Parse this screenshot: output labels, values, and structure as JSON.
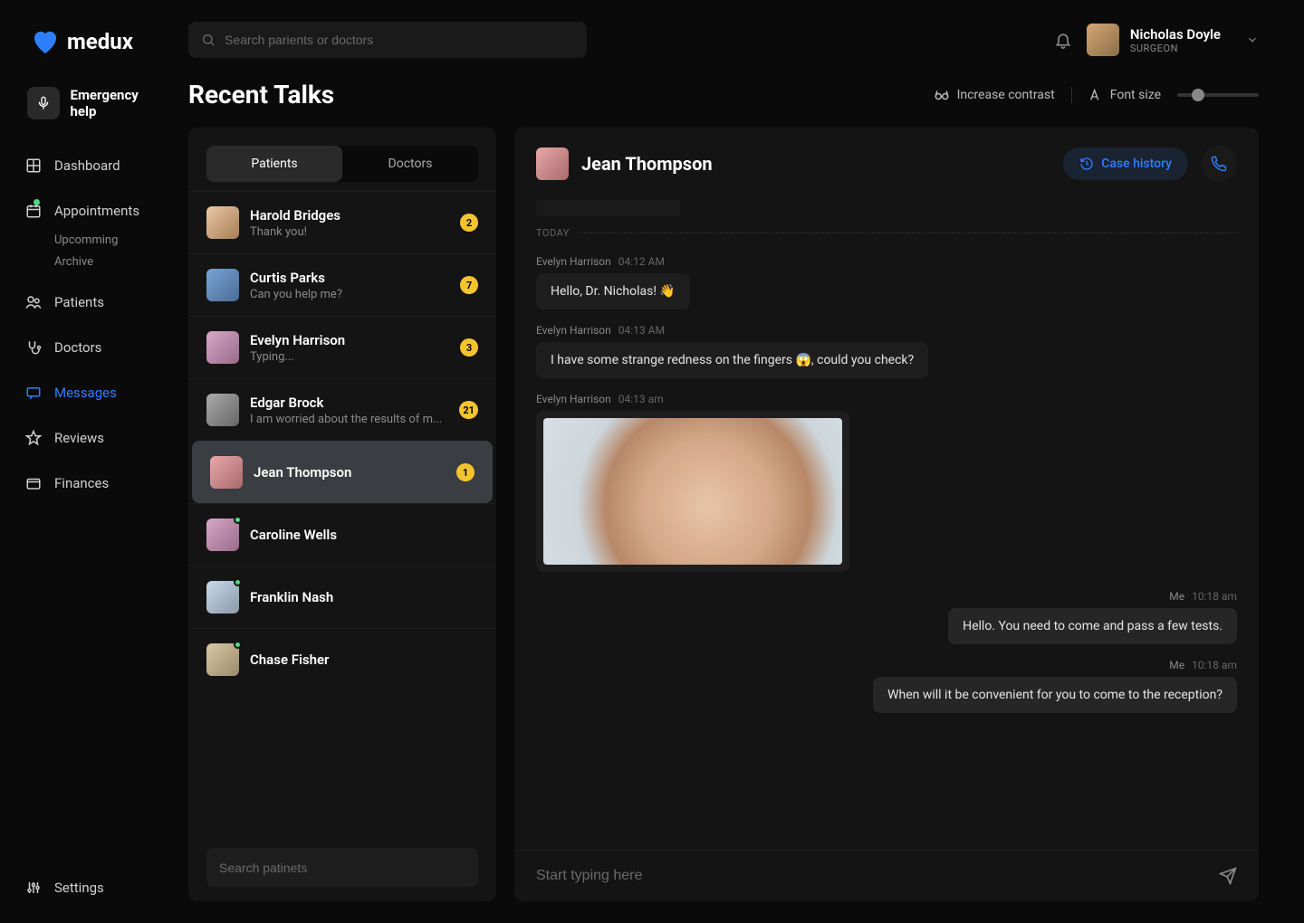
{
  "brand": "medux",
  "search": {
    "placeholder": "Search parients or doctors"
  },
  "user": {
    "name": "Nicholas Doyle",
    "role": "SURGEON"
  },
  "emergency": {
    "label": "Emergency help"
  },
  "nav": {
    "dashboard": "Dashboard",
    "appointments": "Appointments",
    "appointments_sub_upcoming": "Upcomming",
    "appointments_sub_archive": "Archive",
    "patients": "Patients",
    "doctors": "Doctors",
    "messages": "Messages",
    "reviews": "Reviews",
    "finances": "Finances",
    "settings": "Settings"
  },
  "page": {
    "title": "Recent Talks"
  },
  "a11y": {
    "contrast": "Increase contrast",
    "fontsize": "Font size"
  },
  "tabs": {
    "patients": "Patients",
    "doctors": "Doctors"
  },
  "conversations": {
    "0": {
      "name": "Harold Bridges",
      "preview": "Thank you!",
      "badge": "2"
    },
    "1": {
      "name": "Curtis Parks",
      "preview": "Can you help me?",
      "badge": "7"
    },
    "2": {
      "name": "Evelyn Harrison",
      "preview": "Typing...",
      "badge": "3"
    },
    "3": {
      "name": "Edgar Brock",
      "preview": "I am worried about the results of m...",
      "badge": "21"
    },
    "4": {
      "name": "Jean Thompson",
      "preview": "",
      "badge": "1"
    },
    "5": {
      "name": "Caroline Wells",
      "preview": "",
      "badge": ""
    },
    "6": {
      "name": "Franklin Nash",
      "preview": "",
      "badge": ""
    },
    "7": {
      "name": "Chase Fisher",
      "preview": "",
      "badge": ""
    }
  },
  "patient_search": {
    "placeholder": "Search patinets"
  },
  "chat": {
    "contact": "Jean Thompson",
    "case_history": "Case history",
    "day": "TODAY",
    "messages": {
      "0": {
        "author": "Evelyn Harrison",
        "time": "04:12 AM",
        "text": "Hello, Dr. Nicholas! 👋"
      },
      "1": {
        "author": "Evelyn Harrison",
        "time": "04:13 AM",
        "text": "I have some strange redness on the fingers 😱, could you check?"
      },
      "2": {
        "author": "Evelyn Harrison",
        "time": "04:13 am"
      },
      "3": {
        "author": "Me",
        "time": "10:18 am",
        "text": "Hello. You need to come and pass a few tests."
      },
      "4": {
        "author": "Me",
        "time": "10:18 am",
        "text": "When will it be convenient for you to come to the reception?"
      }
    },
    "composer_placeholder": "Start typing here"
  }
}
